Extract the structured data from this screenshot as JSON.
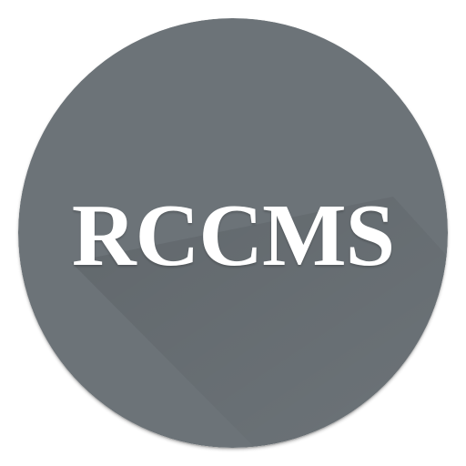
{
  "logo": {
    "text": "RCCMS"
  },
  "colors": {
    "circle_base": "#6c7378",
    "circle_shadow": "#5f666b",
    "text": "#ffffff"
  }
}
